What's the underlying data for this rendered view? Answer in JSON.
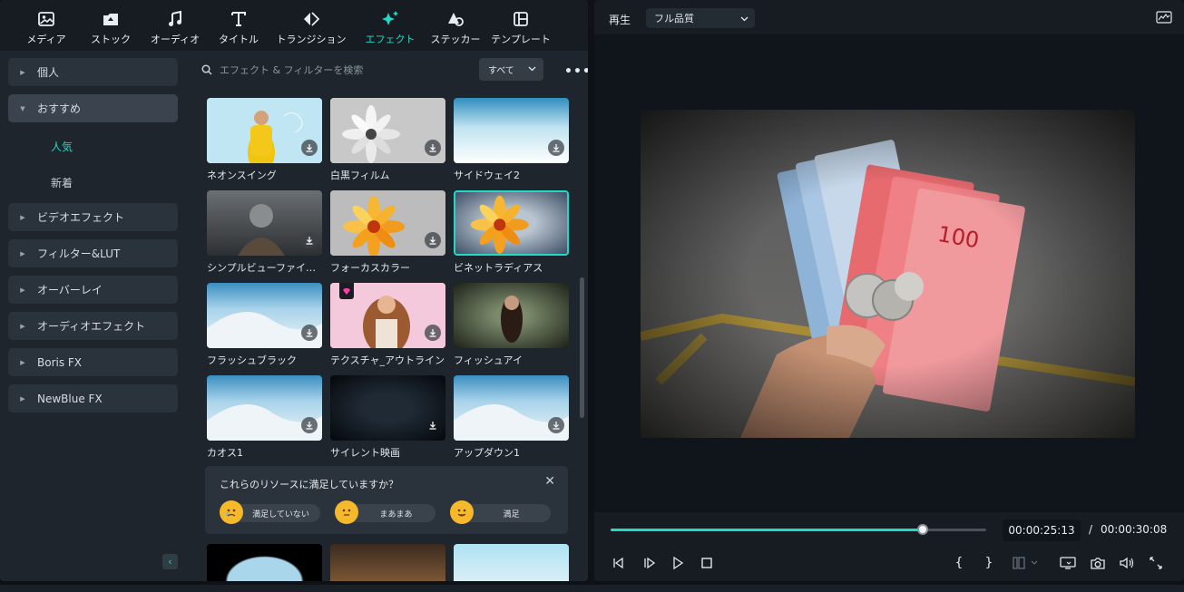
{
  "nav": {
    "tabs": [
      {
        "label": "メディア",
        "icon": "media-icon"
      },
      {
        "label": "ストック",
        "icon": "stock-icon"
      },
      {
        "label": "オーディオ",
        "icon": "audio-icon"
      },
      {
        "label": "タイトル",
        "icon": "title-icon"
      },
      {
        "label": "トランジション",
        "icon": "transition-icon"
      },
      {
        "label": "エフェクト",
        "icon": "effect-icon"
      },
      {
        "label": "ステッカー",
        "icon": "sticker-icon"
      },
      {
        "label": "テンプレート",
        "icon": "template-icon"
      }
    ],
    "active": "エフェクト"
  },
  "sidebar": {
    "categories": [
      {
        "label": "個人"
      },
      {
        "label": "おすすめ"
      },
      {
        "label": "ビデオエフェクト"
      },
      {
        "label": "フィルター&LUT"
      },
      {
        "label": "オーバーレイ"
      },
      {
        "label": "オーディオエフェクト"
      },
      {
        "label": "Boris FX"
      },
      {
        "label": "NewBlue FX"
      }
    ],
    "sub": [
      {
        "label": "人気"
      },
      {
        "label": "新着"
      }
    ]
  },
  "search": {
    "placeholder": "エフェクト & フィルターを検索",
    "filter": "すべて",
    "more": "•••"
  },
  "effects": [
    {
      "name": "ネオンスイング"
    },
    {
      "name": "白黒フィルム"
    },
    {
      "name": "サイドウェイ2"
    },
    {
      "name": "シンプルビューファインダー"
    },
    {
      "name": "フォーカスカラー"
    },
    {
      "name": "ビネットラディアス"
    },
    {
      "name": "フラッシュブラック"
    },
    {
      "name": "テクスチャ_アウトライン"
    },
    {
      "name": "フィッシュアイ"
    },
    {
      "name": "カオス1"
    },
    {
      "name": "サイレント映画"
    },
    {
      "name": "アップダウン1"
    }
  ],
  "survey": {
    "question": "これらのリソースに満足していますか？",
    "options": [
      {
        "label": "満足していない"
      },
      {
        "label": "まあまあ"
      },
      {
        "label": "満足"
      }
    ]
  },
  "player": {
    "play_label": "再生",
    "quality": "フル品質",
    "current_time": "00:00:25:13",
    "separator": "/",
    "total_time": "00:00:30:08",
    "progress": 0.83,
    "mark_in": "{",
    "mark_out": "}"
  },
  "colors": {
    "accent": "#22d8c6"
  }
}
